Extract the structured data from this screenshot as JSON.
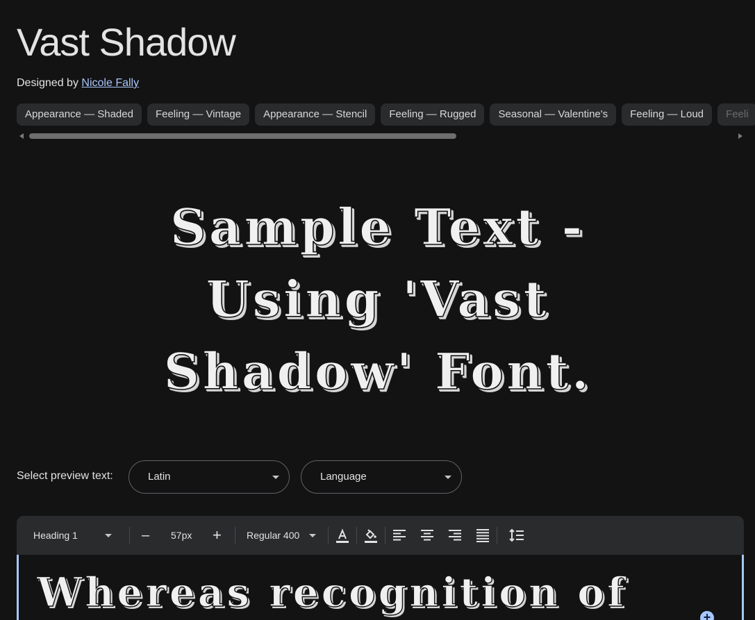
{
  "font": {
    "name": "Vast Shadow",
    "designed_by_prefix": "Designed by",
    "designer": "Nicole Fally"
  },
  "tags": [
    {
      "label": "Appearance — Shaded"
    },
    {
      "label": "Feeling — Vintage"
    },
    {
      "label": "Appearance — Stencil"
    },
    {
      "label": "Feeling — Rugged"
    },
    {
      "label": "Seasonal — Valentine's"
    },
    {
      "label": "Feeling — Loud"
    },
    {
      "label": "Feeli"
    }
  ],
  "preview": {
    "lines": [
      "Sample Text -",
      "Using 'Vast",
      "Shadow' Font."
    ]
  },
  "preview_controls": {
    "label": "Select preview text:",
    "script_select": "Latin",
    "language_select": "Language"
  },
  "toolbar": {
    "style_select": "Heading 1",
    "decrease": "–",
    "size": "57px",
    "increase": "+",
    "weight_select": "Regular 400"
  },
  "editor": {
    "text": "Whereas recognition of"
  },
  "icons": {
    "text_color": "text-color-icon",
    "highlight": "fill-color-icon",
    "align_left": "align-left-icon",
    "align_center": "align-center-icon",
    "align_right": "align-right-icon",
    "justify": "align-justify-icon",
    "line_height": "line-height-icon",
    "add": "add-icon"
  },
  "colors": {
    "background": "#131314",
    "chip": "#2a2b2d",
    "link": "#a8c7fa",
    "accent": "#a8c7fa"
  }
}
